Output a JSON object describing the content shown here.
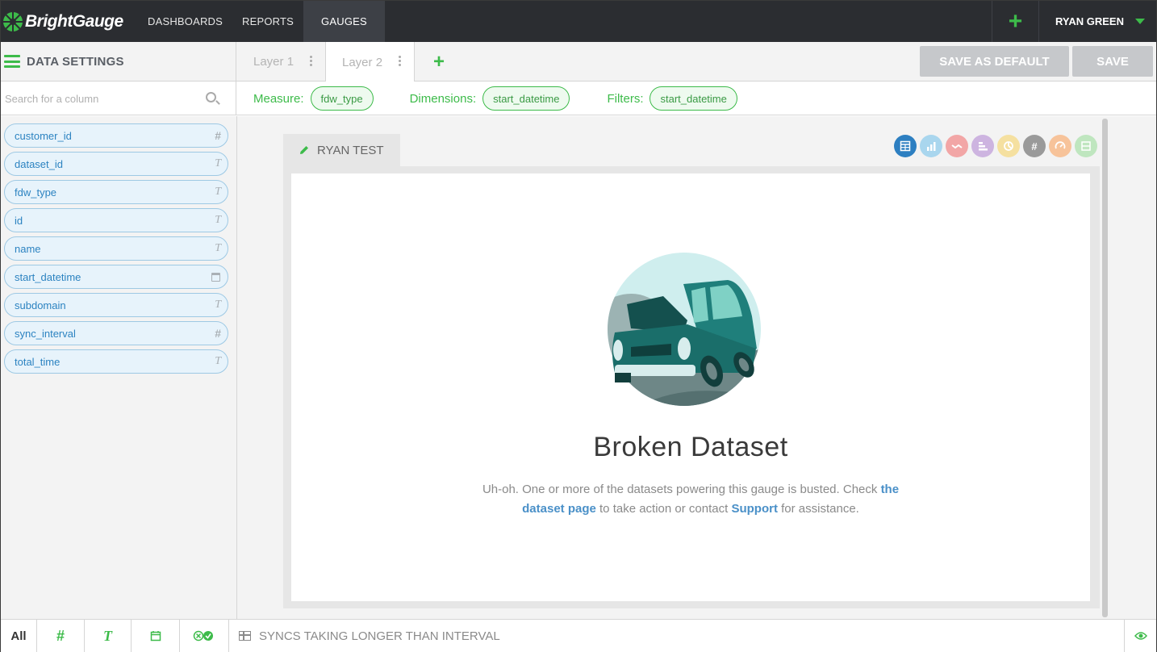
{
  "app": {
    "logo_text": "BrightGauge",
    "accent": "#3dbb4a"
  },
  "topnav": {
    "links": [
      "DASHBOARDS",
      "REPORTS",
      "GAUGES"
    ],
    "active": "GAUGES",
    "add_icon": "plus-icon",
    "user_name": "RYAN GREEN"
  },
  "data_settings": {
    "title": "DATA SETTINGS"
  },
  "layers": {
    "tabs": [
      "Layer 1",
      "Layer 2"
    ],
    "active": "Layer 2"
  },
  "actions": {
    "save_default": "SAVE AS DEFAULT",
    "save": "SAVE"
  },
  "search": {
    "placeholder": "Search for a column"
  },
  "filterbar": {
    "measure_label": "Measure:",
    "measure_value": "fdw_type",
    "dimensions_label": "Dimensions:",
    "dimensions_value": "start_datetime",
    "filters_label": "Filters:",
    "filters_value": "start_datetime"
  },
  "columns": [
    {
      "name": "customer_id",
      "type": "#"
    },
    {
      "name": "dataset_id",
      "type": "T"
    },
    {
      "name": "fdw_type",
      "type": "T"
    },
    {
      "name": "id",
      "type": "T"
    },
    {
      "name": "name",
      "type": "T"
    },
    {
      "name": "start_datetime",
      "type": "calendar"
    },
    {
      "name": "subdomain",
      "type": "T"
    },
    {
      "name": "sync_interval",
      "type": "#"
    },
    {
      "name": "total_time",
      "type": "T"
    }
  ],
  "gauge": {
    "name": "RYAN TEST",
    "type_icons": [
      {
        "icon": "table-icon",
        "color": "#2d7fc1"
      },
      {
        "icon": "bar-chart-icon",
        "color": "#a9d6ee"
      },
      {
        "icon": "line-chart-icon",
        "color": "#f2a6a6"
      },
      {
        "icon": "horizontal-bar-icon",
        "color": "#cdb4e0"
      },
      {
        "icon": "pie-icon",
        "color": "#f5e0a0"
      },
      {
        "icon": "number-icon",
        "color": "#9a9a9a"
      },
      {
        "icon": "gauge-dial-icon",
        "color": "#f7c39a"
      },
      {
        "icon": "list-icon",
        "color": "#bfe6bf"
      }
    ],
    "error_title": "Broken Dataset",
    "error_text_1": "Uh-oh. One or more of the datasets powering this gauge is busted. Check",
    "error_link_1": "the dataset page",
    "error_text_2": "to take action or contact",
    "error_link_2": "Support",
    "error_text_3": "for assistance."
  },
  "bottombar": {
    "all_label": "All",
    "sync_label": "SYNCS TAKING LONGER THAN INTERVAL"
  }
}
